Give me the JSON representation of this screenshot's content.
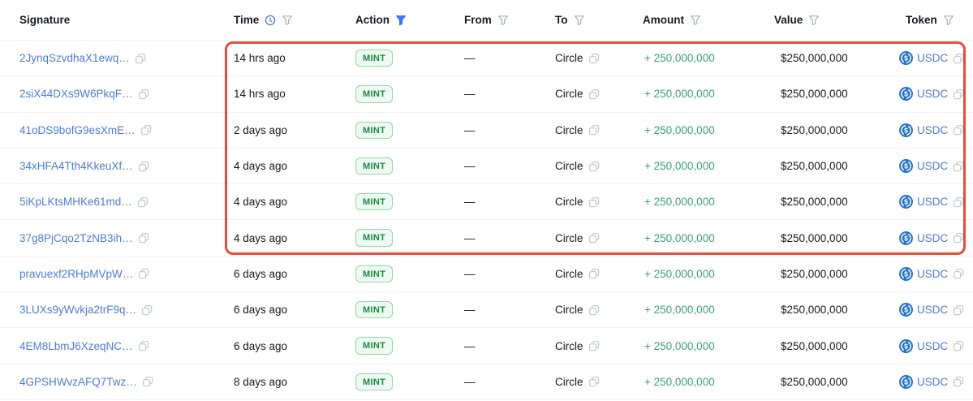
{
  "table": {
    "columns": [
      {
        "key": "signature",
        "label": "Signature"
      },
      {
        "key": "time",
        "label": "Time"
      },
      {
        "key": "action",
        "label": "Action"
      },
      {
        "key": "from",
        "label": "From"
      },
      {
        "key": "to",
        "label": "To"
      },
      {
        "key": "amount",
        "label": "Amount"
      },
      {
        "key": "value",
        "label": "Value"
      },
      {
        "key": "token",
        "label": "Token"
      }
    ],
    "rows": [
      {
        "signature": "2JynqSzvdhaX1ewq…",
        "time": "14 hrs ago",
        "action": "MINT",
        "from": "—",
        "to": "Circle",
        "amount": "+ 250,000,000",
        "value": "$250,000,000",
        "token": "USDC"
      },
      {
        "signature": "2siX44DXs9W6PkqF…",
        "time": "14 hrs ago",
        "action": "MINT",
        "from": "—",
        "to": "Circle",
        "amount": "+ 250,000,000",
        "value": "$250,000,000",
        "token": "USDC"
      },
      {
        "signature": "41oDS9bofG9esXmE…",
        "time": "2 days ago",
        "action": "MINT",
        "from": "—",
        "to": "Circle",
        "amount": "+ 250,000,000",
        "value": "$250,000,000",
        "token": "USDC"
      },
      {
        "signature": "34xHFA4Tth4KkeuXf…",
        "time": "4 days ago",
        "action": "MINT",
        "from": "—",
        "to": "Circle",
        "amount": "+ 250,000,000",
        "value": "$250,000,000",
        "token": "USDC"
      },
      {
        "signature": "5iKpLKtsMHKe61md…",
        "time": "4 days ago",
        "action": "MINT",
        "from": "—",
        "to": "Circle",
        "amount": "+ 250,000,000",
        "value": "$250,000,000",
        "token": "USDC"
      },
      {
        "signature": "37g8PjCqo2TzNB3ih…",
        "time": "4 days ago",
        "action": "MINT",
        "from": "—",
        "to": "Circle",
        "amount": "+ 250,000,000",
        "value": "$250,000,000",
        "token": "USDC"
      },
      {
        "signature": "pravuexf2RHpMVpW…",
        "time": "6 days ago",
        "action": "MINT",
        "from": "—",
        "to": "Circle",
        "amount": "+ 250,000,000",
        "value": "$250,000,000",
        "token": "USDC"
      },
      {
        "signature": "3LUXs9yWvkja2trF9q…",
        "time": "6 days ago",
        "action": "MINT",
        "from": "—",
        "to": "Circle",
        "amount": "+ 250,000,000",
        "value": "$250,000,000",
        "token": "USDC"
      },
      {
        "signature": "4EM8LbmJ6XzeqNC…",
        "time": "6 days ago",
        "action": "MINT",
        "from": "—",
        "to": "Circle",
        "amount": "+ 250,000,000",
        "value": "$250,000,000",
        "token": "USDC"
      },
      {
        "signature": "4GPSHWvzAFQ7Twz…",
        "time": "8 days ago",
        "action": "MINT",
        "from": "—",
        "to": "Circle",
        "amount": "+ 250,000,000",
        "value": "$250,000,000",
        "token": "USDC"
      }
    ]
  },
  "highlight": {
    "description": "red annotation box around rows 1-6, Time through Token columns",
    "row_start": 1,
    "row_end": 6
  },
  "colors": {
    "text-dark": "#16181d",
    "link-blue": "#4d7cd2",
    "amount-green": "#3aa271",
    "badge-green-text": "#1a8a45",
    "badge-green-bg": "#eefaf1",
    "badge-green-border": "#8fd9a8",
    "highlight-red": "#e2503c",
    "filter-active-blue": "#3b78f0",
    "clock-blue": "#4d7cd2",
    "usdc-blue": "#2775ca",
    "icon-gray": "#a9aeb8",
    "copy-gray": "#c6cad1",
    "divider": "#f0f1f4"
  }
}
